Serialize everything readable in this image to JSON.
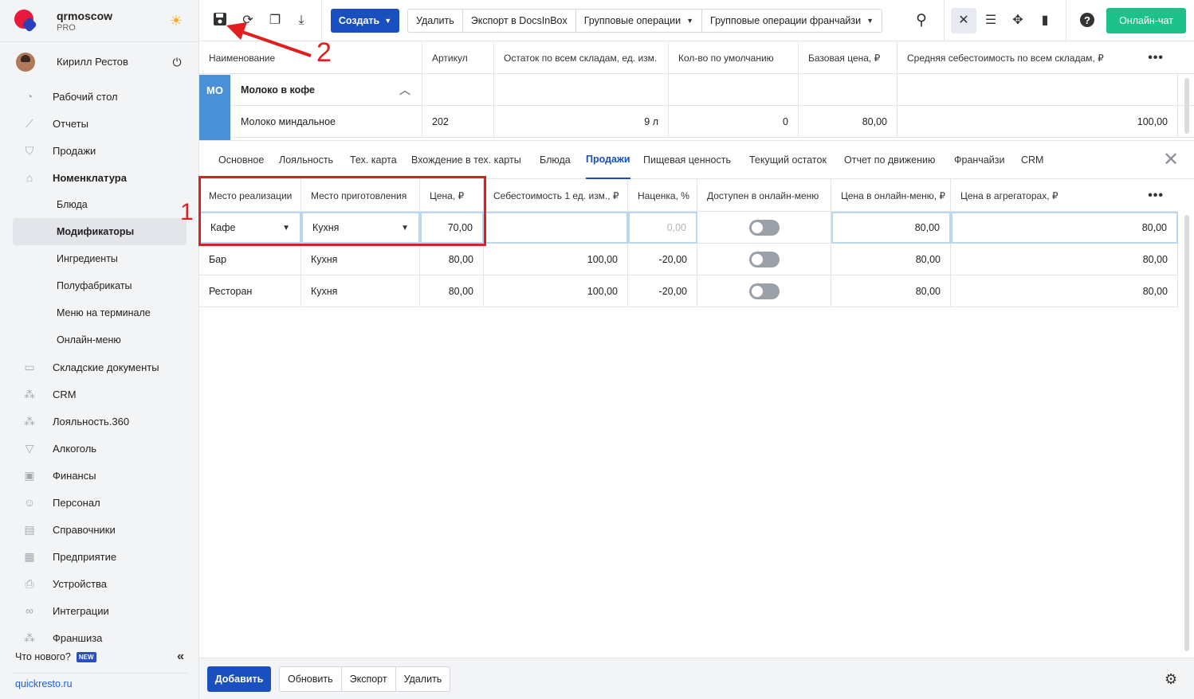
{
  "brand": {
    "name": "qrmoscow",
    "plan": "PRO"
  },
  "user": {
    "name": "Кирилл Рестов"
  },
  "sidebar": {
    "items": [
      {
        "label": "Рабочий стол",
        "icon": "dashboard-icon"
      },
      {
        "label": "Отчеты",
        "icon": "reports-icon"
      },
      {
        "label": "Продажи",
        "icon": "basket-icon"
      },
      {
        "label": "Номенклатура",
        "icon": "tag-icon"
      }
    ],
    "subitems": [
      "Блюда",
      "Модификаторы",
      "Ингредиенты",
      "Полуфабрикаты",
      "Меню на терминале",
      "Онлайн-меню"
    ],
    "items2": [
      {
        "label": "Складские документы",
        "icon": "warehouse-icon"
      },
      {
        "label": "CRM",
        "icon": "crm-icon"
      },
      {
        "label": "Лояльность.360",
        "icon": "loyalty-icon"
      },
      {
        "label": "Алкоголь",
        "icon": "glass-icon"
      },
      {
        "label": "Финансы",
        "icon": "wallet-icon"
      },
      {
        "label": "Персонал",
        "icon": "people-icon"
      },
      {
        "label": "Справочники",
        "icon": "book-icon"
      },
      {
        "label": "Предприятие",
        "icon": "store-icon"
      },
      {
        "label": "Устройства",
        "icon": "printer-icon"
      },
      {
        "label": "Интеграции",
        "icon": "infinity-icon"
      },
      {
        "label": "Франшиза",
        "icon": "network-icon"
      }
    ],
    "whats_new": "Что нового?",
    "new_badge": "NEW",
    "site": "quickresto.ru"
  },
  "toolbar": {
    "create": "Создать",
    "delete": "Удалить",
    "export": "Экспорт в DocsInBox",
    "group_ops": "Групповые операции",
    "group_ops_franchise": "Групповые операции франчайзи",
    "chat": "Онлайн-чат"
  },
  "top_grid": {
    "headers": [
      "Наименование",
      "Артикул",
      "Остаток по всем складам, ед. изм.",
      "Кол-во по умолчанию",
      "Базовая цена, ₽",
      "Средняя себестоимость по всем складам, ₽"
    ],
    "group": {
      "badge": "МО",
      "name": "Молоко в кофе"
    },
    "row": {
      "name": "Молоко миндальное",
      "article": "202",
      "stock": "9 л",
      "default_qty": "0",
      "base_price": "80,00",
      "avg_cost": "100,00"
    }
  },
  "tabs": [
    "Основное",
    "Лояльность",
    "Тех. карта",
    "Вхождение в тех. карты",
    "Блюда",
    "Продажи",
    "Пищевая ценность",
    "Текущий остаток",
    "Отчет по движению",
    "Франчайзи",
    "CRM"
  ],
  "active_tab": "Продажи",
  "sales_grid": {
    "headers": [
      "Место реализации",
      "Место приготовления",
      "Цена, ₽",
      "Себестоимость 1 ед. изм., ₽",
      "Наценка, %",
      "Доступен в онлайн-меню",
      "Цена в онлайн-меню, ₽",
      "Цена в агрегаторах, ₽"
    ],
    "rows": [
      {
        "place": "Кафе",
        "kitchen": "Кухня",
        "price": "70,00",
        "cost": "",
        "markup": "0,00",
        "online": false,
        "online_price": "80,00",
        "agg_price": "80,00"
      },
      {
        "place": "Бар",
        "kitchen": "Кухня",
        "price": "80,00",
        "cost": "100,00",
        "markup": "-20,00",
        "online": false,
        "online_price": "80,00",
        "agg_price": "80,00"
      },
      {
        "place": "Ресторан",
        "kitchen": "Кухня",
        "price": "80,00",
        "cost": "100,00",
        "markup": "-20,00",
        "online": false,
        "online_price": "80,00",
        "agg_price": "80,00"
      }
    ]
  },
  "annotations": {
    "first": "1",
    "second": "2",
    "color": "#e01e1e"
  },
  "bottombar": {
    "add": "Добавить",
    "refresh": "Обновить",
    "export": "Экспорт",
    "delete": "Удалить"
  },
  "colors": {
    "accent": "#1a4fbf",
    "chat": "#1ec18a",
    "group_badge": "#4a90d9"
  }
}
